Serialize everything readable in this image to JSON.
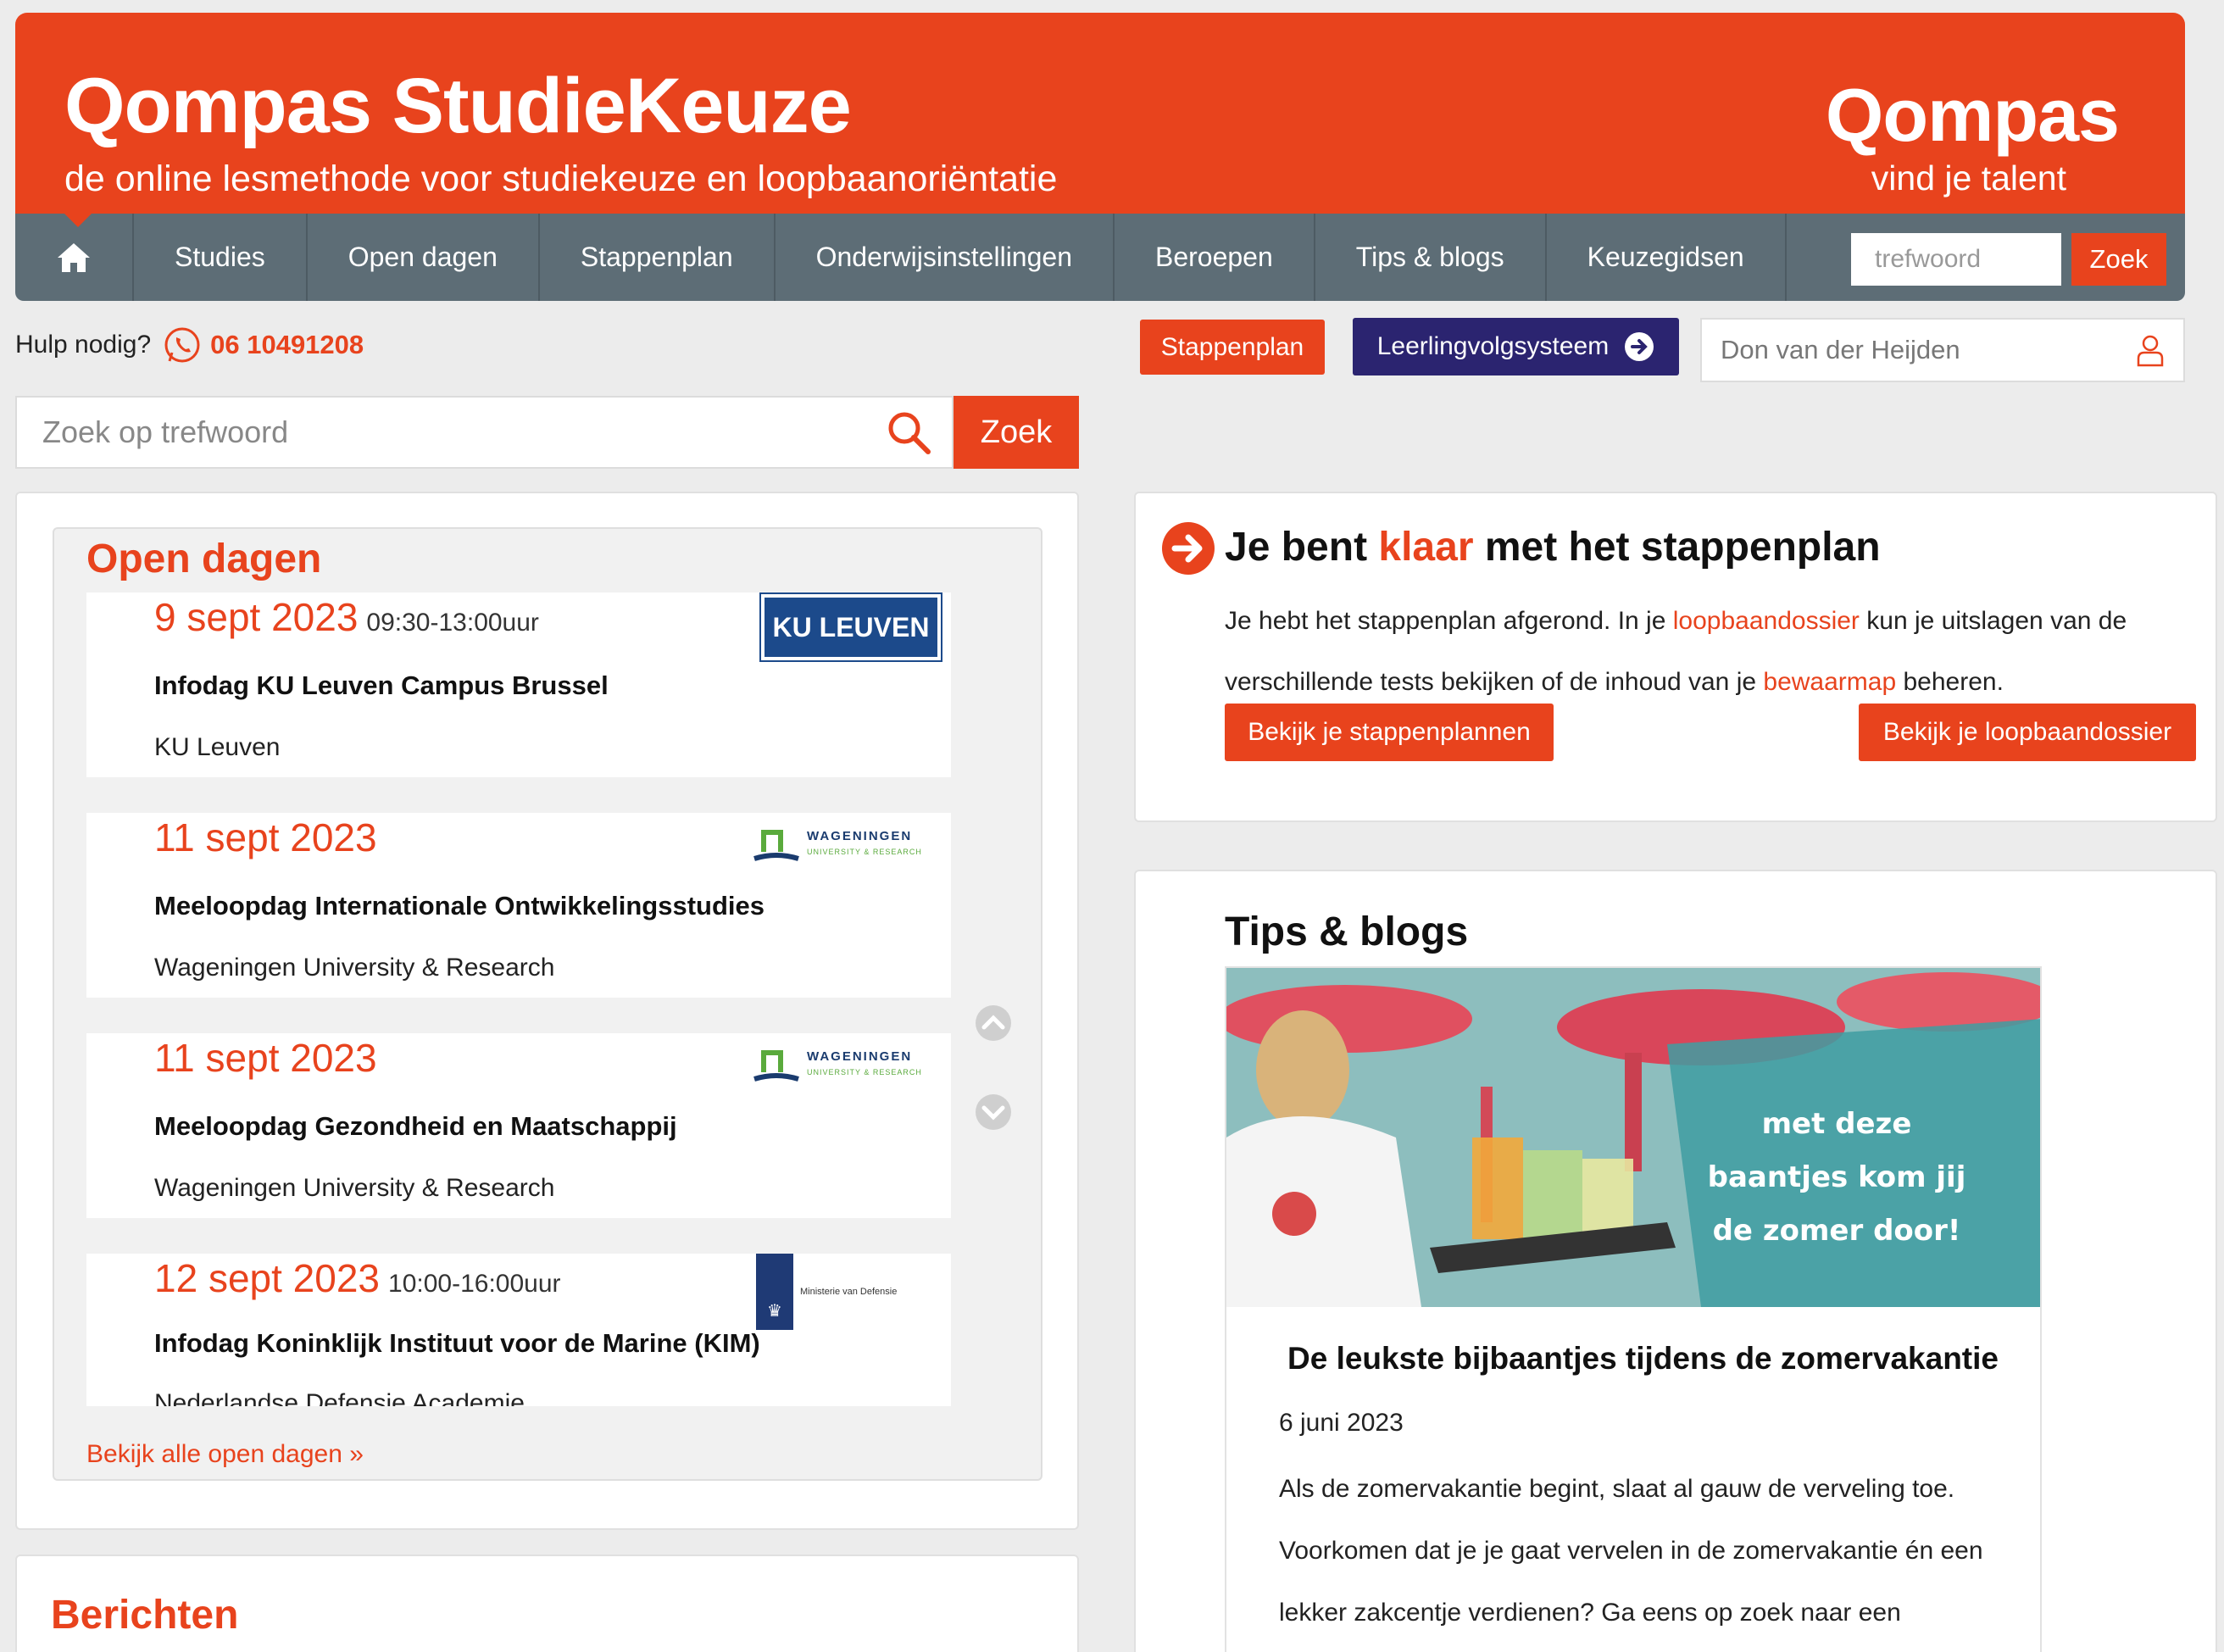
{
  "header": {
    "title": "Qompas StudieKeuze",
    "subtitle": "de online lesmethode voor studiekeuze en loopbaanoriëntatie",
    "logo": "Qompas",
    "logo_tagline": "vind je talent",
    "brand_color": "#e8431d"
  },
  "nav": {
    "items": [
      "Studies",
      "Open dagen",
      "Stappenplan",
      "Onderwijsinstellingen",
      "Beroepen",
      "Tips & blogs",
      "Keuzegidsen"
    ],
    "search_placeholder": "trefwoord",
    "search_button": "Zoek"
  },
  "util": {
    "help_label": "Hulp nodig?",
    "phone": "06 10491208",
    "stappenplan_button": "Stappenplan",
    "leerling_button": "Leerlingvolgsysteem",
    "user_name": "Don van der Heijden"
  },
  "search": {
    "placeholder": "Zoek op trefwoord",
    "button": "Zoek"
  },
  "open_dagen": {
    "title": "Open dagen",
    "events": [
      {
        "date": "9 sept 2023",
        "time": "09:30-13:00uur",
        "name": "Infodag KU Leuven Campus Brussel",
        "org": "KU Leuven",
        "logo": "KU LEUVEN"
      },
      {
        "date": "11 sept 2023",
        "time": "",
        "name": "Meeloopdag Internationale Ontwikkelingsstudies",
        "org": "Wageningen University & Research",
        "logo": "WAGENINGEN"
      },
      {
        "date": "11 sept 2023",
        "time": "",
        "name": "Meeloopdag Gezondheid en Maatschappij",
        "org": "Wageningen University & Research",
        "logo": "WAGENINGEN"
      },
      {
        "date": "12 sept 2023",
        "time": "10:00-16:00uur",
        "name": "Infodag Koninklijk Instituut voor de Marine (KIM)",
        "org": "Nederlandse Defensie Academie",
        "logo": "Ministerie van Defensie"
      }
    ],
    "logo_sub": "UNIVERSITY & RESEARCH",
    "more_link": "Bekijk alle open dagen »"
  },
  "berichten": {
    "title": "Berichten"
  },
  "klaar": {
    "title_prefix": "Je bent ",
    "title_highlight": "klaar",
    "title_suffix": " met het stappenplan",
    "text_1": "Je hebt het stappenplan afgerond. In je ",
    "link_1": "loopbaandossier",
    "text_2": " kun je uitslagen van de verschillende tests bekijken of de inhoud van je ",
    "link_2": "bewaarmap",
    "text_3": " beheren.",
    "button_1": "Bekijk je stappenplannen",
    "button_2": "Bekijk je loopbaandossier"
  },
  "tips": {
    "title": "Tips & blogs",
    "image_caption": "met deze baantjes kom jij de zomer door!",
    "caption_lines": [
      "met deze",
      "baantjes kom jij",
      "de zomer door!"
    ],
    "blog_title": "De leukste bijbaantjes tijdens de zomervakantie",
    "blog_date": "6 juni 2023",
    "blog_text": "Als de zomervakantie begint, slaat al gauw de verveling toe. Voorkomen dat je je gaat vervelen in de zomervakantie én een lekker zakcentje verdienen? Ga eens op zoek naar een"
  }
}
